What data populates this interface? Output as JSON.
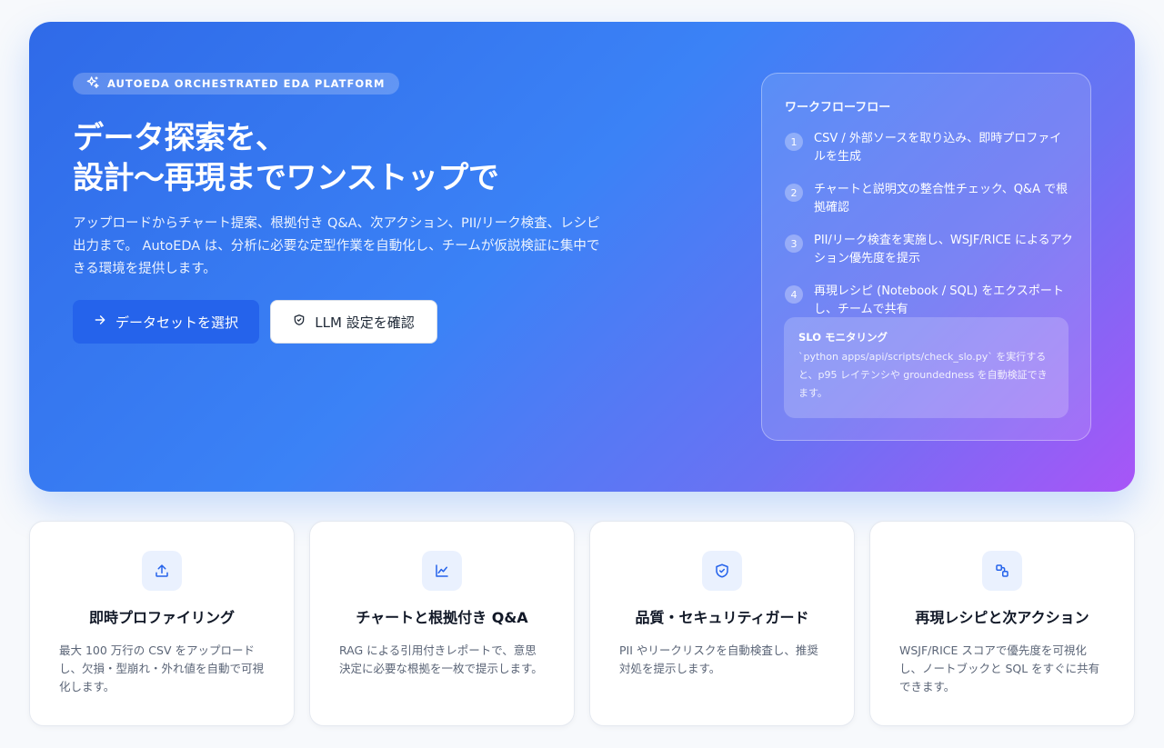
{
  "hero": {
    "badge": "AUTOEDA ORCHESTRATED EDA PLATFORM",
    "title_line1": "データ探索を、",
    "title_line2": "設計〜再現までワンストップで",
    "description": "アップロードからチャート提案、根拠付き Q&A、次アクション、PII/リーク検査、レシピ出力まで。 AutoEDA は、分析に必要な定型作業を自動化し、チームが仮説検証に集中できる環境を提供します。",
    "primary_button": "データセットを選択",
    "secondary_button": "LLM 設定を確認"
  },
  "workflow": {
    "title": "ワークフローフロー",
    "steps": [
      {
        "num": "1",
        "text": "CSV / 外部ソースを取り込み、即時プロファイルを生成"
      },
      {
        "num": "2",
        "text": "チャートと説明文の整合性チェック、Q&A で根拠確認"
      },
      {
        "num": "3",
        "text": "PII/リーク検査を実施し、WSJF/RICE によるアクション優先度を提示"
      },
      {
        "num": "4",
        "text": "再現レシピ (Notebook / SQL) をエクスポートし、チームで共有"
      }
    ],
    "slo": {
      "title": "SLO モニタリング",
      "text": "`python apps/api/scripts/check_slo.py` を実行すると、p95 レイテンシや groundedness を自動検証できます。"
    }
  },
  "features": [
    {
      "icon": "upload-icon",
      "title": "即時プロファイリング",
      "desc": "最大 100 万行の CSV をアップロードし、欠損・型崩れ・外れ値を自動で可視化します。"
    },
    {
      "icon": "line-chart-icon",
      "title": "チャートと根拠付き Q&A",
      "desc": "RAG による引用付きレポートで、意思決定に必要な根拠を一枚で提示します。"
    },
    {
      "icon": "shield-check-icon",
      "title": "品質・セキュリティガード",
      "desc": "PII やリークリスクを自動検査し、推奨対処を提示します。"
    },
    {
      "icon": "workflow-icon",
      "title": "再現レシピと次アクション",
      "desc": "WSJF/RICE スコアで優先度を可視化し、ノートブックと SQL をすぐに共有できます。"
    }
  ],
  "colors": {
    "accent": "#2563eb",
    "gradient_start": "#2f6ae8",
    "gradient_end": "#a855f7",
    "icon_bg": "#eaf1fe"
  }
}
